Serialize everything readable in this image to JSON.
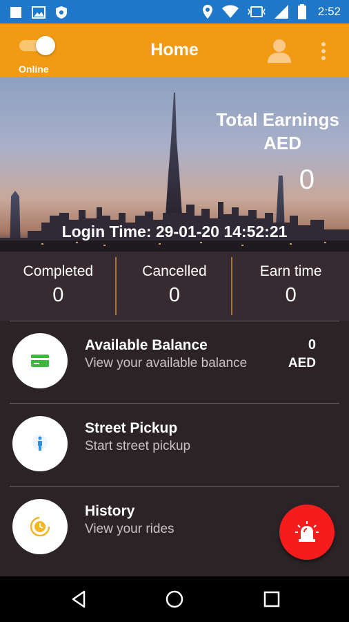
{
  "status_bar": {
    "time": "2:52",
    "left_icons": [
      "square-notification-icon",
      "image-notification-icon",
      "shield-notification-icon"
    ],
    "right_icons": [
      "location-icon",
      "wifi-icon",
      "vibrate-icon",
      "signal-icon",
      "battery-icon"
    ],
    "background": "#1e77c9"
  },
  "app_bar": {
    "title": "Home",
    "toggle_label": "Online",
    "toggle_on": true,
    "background": "#f39a14"
  },
  "hero": {
    "earnings_title": "Total Earnings",
    "earnings_currency": "AED",
    "earnings_value": "0",
    "login_time": "Login Time: 29-01-20  14:52:21"
  },
  "stats": [
    {
      "label": "Completed",
      "value": "0"
    },
    {
      "label": "Cancelled",
      "value": "0"
    },
    {
      "label": "Earn time",
      "value": "0"
    }
  ],
  "menu": {
    "balance": {
      "title": "Available Balance",
      "subtitle": "View your available balance",
      "value": "0",
      "currency": "AED",
      "icon": "card-icon"
    },
    "street_pickup": {
      "title": "Street Pickup",
      "subtitle": "Start street pickup",
      "icon": "person-pickup-icon"
    },
    "history": {
      "title": "History",
      "subtitle": "View your rides",
      "icon": "clock-history-icon"
    }
  },
  "colors": {
    "accent": "#f39a14",
    "stats_bg": "#372a30",
    "list_bg": "#2c2327",
    "sos": "#f41c1c",
    "card_green": "#3dba3d"
  },
  "nav": [
    "back-icon",
    "home-icon",
    "recents-icon"
  ]
}
